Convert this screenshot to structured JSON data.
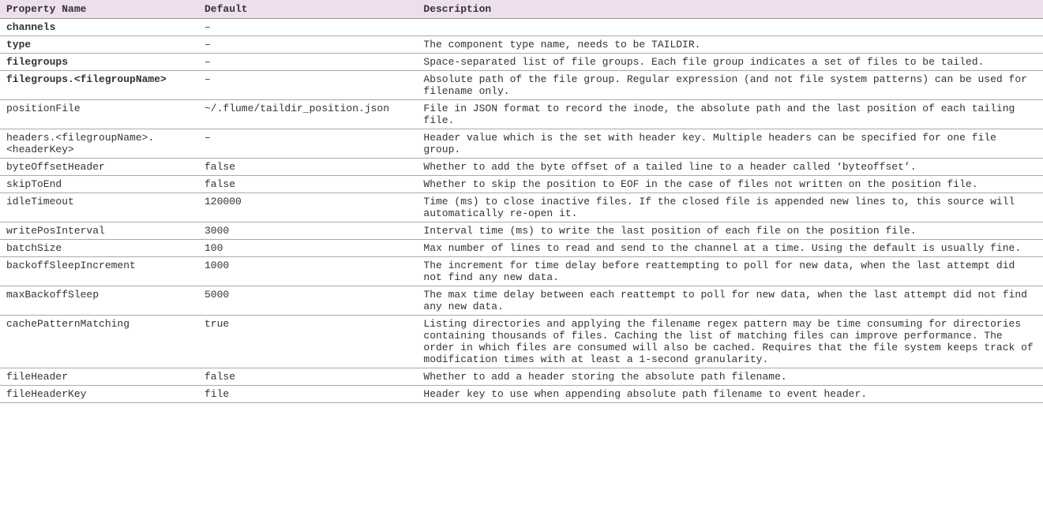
{
  "headers": {
    "name": "Property Name",
    "default": "Default",
    "description": "Description"
  },
  "rows": [
    {
      "name": "channels",
      "bold": true,
      "default": "–",
      "description": ""
    },
    {
      "name": "type",
      "bold": true,
      "default": "–",
      "description": "The component type name, needs to be TAILDIR."
    },
    {
      "name": "filegroups",
      "bold": true,
      "default": "–",
      "description": "Space-separated list of file groups. Each file group indicates a set of files to be tailed."
    },
    {
      "name": "filegroups.<filegroupName>",
      "bold": true,
      "default": "–",
      "description": "Absolute path of the file group. Regular expression (and not file system patterns) can be used for filename only."
    },
    {
      "name": "positionFile",
      "bold": false,
      "default": "~/.flume/taildir_position.json",
      "description": "File in JSON format to record the inode, the absolute path and the last position of each tailing file."
    },
    {
      "name": "headers.<filegroupName>.<headerKey>",
      "bold": false,
      "default": "–",
      "description": "Header value which is the set with header key. Multiple headers can be specified for one file group."
    },
    {
      "name": "byteOffsetHeader",
      "bold": false,
      "default": "false",
      "description": "Whether to add the byte offset of a tailed line to a header called ‘byteoffset’."
    },
    {
      "name": "skipToEnd",
      "bold": false,
      "default": "false",
      "description": "Whether to skip the position to EOF in the case of files not written on the position file."
    },
    {
      "name": "idleTimeout",
      "bold": false,
      "default": "120000",
      "description": "Time (ms) to close inactive files. If the closed file is appended new lines to, this source will automatically re-open it."
    },
    {
      "name": "writePosInterval",
      "bold": false,
      "default": "3000",
      "description": "Interval time (ms) to write the last position of each file on the position file."
    },
    {
      "name": "batchSize",
      "bold": false,
      "default": "100",
      "description": "Max number of lines to read and send to the channel at a time. Using the default is usually fine."
    },
    {
      "name": "backoffSleepIncrement",
      "bold": false,
      "default": "1000",
      "description": "The increment for time delay before reattempting to poll for new data, when the last attempt did not find any new data."
    },
    {
      "name": "maxBackoffSleep",
      "bold": false,
      "default": "5000",
      "description": "The max time delay between each reattempt to poll for new data, when the last attempt did not find any new data."
    },
    {
      "name": "cachePatternMatching",
      "bold": false,
      "default": "true",
      "description": "Listing directories and applying the filename regex pattern may be time consuming for directories containing thousands of files. Caching the list of matching files can improve performance. The order in which files are consumed will also be cached. Requires that the file system keeps track of modification times with at least a 1-second granularity."
    },
    {
      "name": "fileHeader",
      "bold": false,
      "default": "false",
      "description": "Whether to add a header storing the absolute path filename."
    },
    {
      "name": "fileHeaderKey",
      "bold": false,
      "default": "file",
      "description": "Header key to use when appending absolute path filename to event header."
    }
  ]
}
